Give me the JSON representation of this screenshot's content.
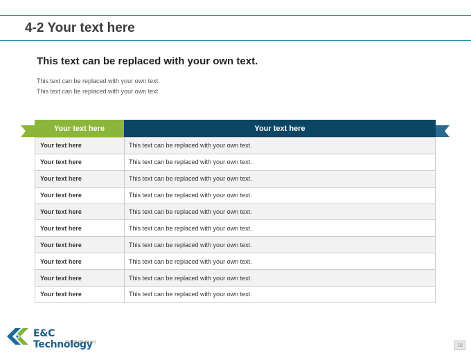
{
  "slide": {
    "title": "4-2 Your text here",
    "subtitle": "This text can be replaced with your own text.",
    "body_lines": [
      "This text can be replaced with your own text.",
      "This text can be replaced with your own text."
    ],
    "page_number": "18"
  },
  "table": {
    "headers": [
      "Your text here",
      "Your text here"
    ],
    "header_colors": [
      "#8bb63a",
      "#0b4663"
    ],
    "rows": [
      [
        "Your text here",
        "This text can be replaced with your own text."
      ],
      [
        "Your text here",
        "This text can be replaced with your own text."
      ],
      [
        "Your text here",
        "This text can be replaced with your own text."
      ],
      [
        "Your text here",
        "This text can be replaced with your own text."
      ],
      [
        "Your text here",
        "This text can be replaced with your own text."
      ],
      [
        "Your text here",
        "This text can be replaced with your own text."
      ],
      [
        "Your text here",
        "This text can be replaced with your own text."
      ],
      [
        "Your text here",
        "This text can be replaced with your own text."
      ],
      [
        "Your text here",
        "This text can be replaced with your own text."
      ],
      [
        "Your text here",
        "This text can be replaced with your own text."
      ]
    ]
  },
  "logo": {
    "name": "E&C Technology",
    "sub": "(주)이앤씨테크놀로지",
    "icon": "chevron-logo-icon"
  }
}
